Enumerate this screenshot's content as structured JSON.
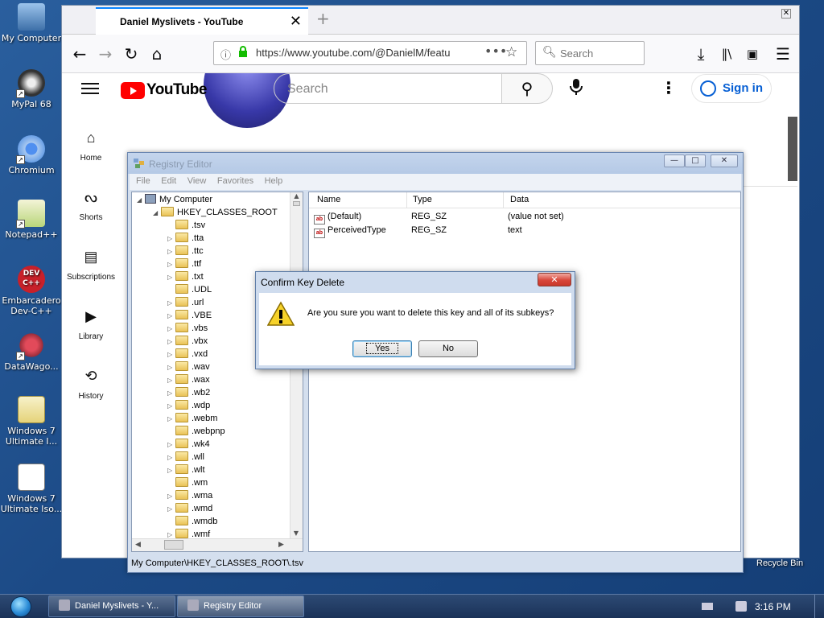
{
  "desktop": {
    "icons": [
      {
        "label": "My Computer"
      },
      {
        "label": "MyPal 68"
      },
      {
        "label": "Chromium"
      },
      {
        "label": "Notepad++"
      },
      {
        "label": "Embarcadero Dev-C++"
      },
      {
        "label": "DataWago..."
      },
      {
        "label": "Windows 7 Ultimate I..."
      },
      {
        "label": "Windows 7 Ultimate Iso..."
      }
    ],
    "recycle_bin": "Recycle Bin"
  },
  "browser": {
    "tab_title": "Daniel Myslivets - YouTube",
    "new_tab": "+",
    "url": "https://www.youtube.com/@DanielM/featu",
    "search_placeholder": "Search"
  },
  "youtube": {
    "logo": "YouTube",
    "search_placeholder": "Search",
    "sign_in": "Sign in",
    "nav": [
      {
        "label": "Home"
      },
      {
        "label": "Shorts"
      },
      {
        "label": "Subscriptions"
      },
      {
        "label": "Library"
      },
      {
        "label": "History"
      }
    ]
  },
  "regedit": {
    "title": "Registry Editor",
    "menu": [
      "File",
      "Edit",
      "View",
      "Favorites",
      "Help"
    ],
    "tree": {
      "root": "My Computer",
      "hive": "HKEY_CLASSES_ROOT",
      "keys": [
        ".tsv",
        ".tta",
        ".ttc",
        ".ttf",
        ".txt",
        ".UDL",
        ".url",
        ".VBE",
        ".vbs",
        ".vbx",
        ".vxd",
        ".wav",
        ".wax",
        ".wb2",
        ".wdp",
        ".webm",
        ".webpnp",
        ".wk4",
        ".wll",
        ".wlt",
        ".wm",
        ".wma",
        ".wmd",
        ".wmdb",
        ".wmf"
      ]
    },
    "columns": {
      "name": "Name",
      "type": "Type",
      "data": "Data"
    },
    "values": [
      {
        "icon": "ab",
        "name": "(Default)",
        "type": "REG_SZ",
        "data": "(value not set)"
      },
      {
        "icon": "ab",
        "name": "PerceivedType",
        "type": "REG_SZ",
        "data": "text"
      }
    ],
    "status": "My Computer\\HKEY_CLASSES_ROOT\\.tsv"
  },
  "dialog": {
    "title": "Confirm Key Delete",
    "message": "Are you sure you want to delete this key and all of its subkeys?",
    "yes": "Yes",
    "no": "No"
  },
  "taskbar": {
    "tasks": [
      {
        "label": "Daniel Myslivets - Y..."
      },
      {
        "label": "Registry Editor"
      }
    ],
    "clock": "3:16 PM"
  }
}
